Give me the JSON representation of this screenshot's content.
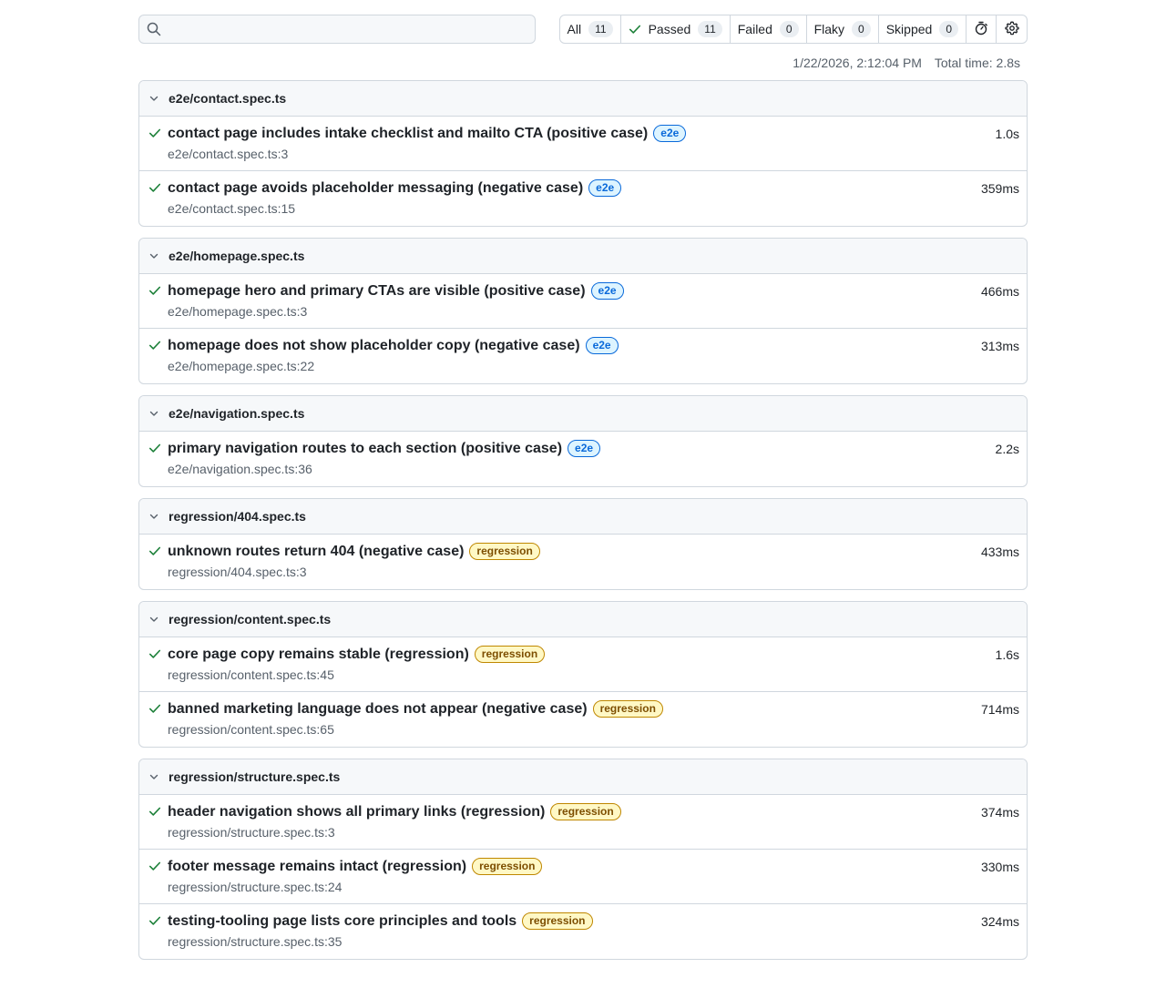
{
  "search": {
    "placeholder": "",
    "value": ""
  },
  "filters": [
    {
      "label": "All",
      "count": "11"
    },
    {
      "label": "Passed",
      "count": "11"
    },
    {
      "label": "Failed",
      "count": "0"
    },
    {
      "label": "Flaky",
      "count": "0"
    },
    {
      "label": "Skipped",
      "count": "0"
    }
  ],
  "meta": {
    "timestamp": "1/22/2026, 2:12:04 PM",
    "total_time": "Total time: 2.8s"
  },
  "colors": {
    "pass": "#1a7f37",
    "e2e": "#0969da",
    "regression": "#bf8700"
  },
  "files": [
    {
      "name": "e2e/contact.spec.ts",
      "tests": [
        {
          "title": "contact page includes intake checklist and mailto CTA (positive case)",
          "tag": "e2e",
          "loc": "e2e/contact.spec.ts:3",
          "duration": "1.0s"
        },
        {
          "title": "contact page avoids placeholder messaging (negative case)",
          "tag": "e2e",
          "loc": "e2e/contact.spec.ts:15",
          "duration": "359ms"
        }
      ]
    },
    {
      "name": "e2e/homepage.spec.ts",
      "tests": [
        {
          "title": "homepage hero and primary CTAs are visible (positive case)",
          "tag": "e2e",
          "loc": "e2e/homepage.spec.ts:3",
          "duration": "466ms"
        },
        {
          "title": "homepage does not show placeholder copy (negative case)",
          "tag": "e2e",
          "loc": "e2e/homepage.spec.ts:22",
          "duration": "313ms"
        }
      ]
    },
    {
      "name": "e2e/navigation.spec.ts",
      "tests": [
        {
          "title": "primary navigation routes to each section (positive case)",
          "tag": "e2e",
          "loc": "e2e/navigation.spec.ts:36",
          "duration": "2.2s"
        }
      ]
    },
    {
      "name": "regression/404.spec.ts",
      "tests": [
        {
          "title": "unknown routes return 404 (negative case)",
          "tag": "regression",
          "loc": "regression/404.spec.ts:3",
          "duration": "433ms"
        }
      ]
    },
    {
      "name": "regression/content.spec.ts",
      "tests": [
        {
          "title": "core page copy remains stable (regression)",
          "tag": "regression",
          "loc": "regression/content.spec.ts:45",
          "duration": "1.6s"
        },
        {
          "title": "banned marketing language does not appear (negative case)",
          "tag": "regression",
          "loc": "regression/content.spec.ts:65",
          "duration": "714ms"
        }
      ]
    },
    {
      "name": "regression/structure.spec.ts",
      "tests": [
        {
          "title": "header navigation shows all primary links (regression)",
          "tag": "regression",
          "loc": "regression/structure.spec.ts:3",
          "duration": "374ms"
        },
        {
          "title": "footer message remains intact (regression)",
          "tag": "regression",
          "loc": "regression/structure.spec.ts:24",
          "duration": "330ms"
        },
        {
          "title": "testing-tooling page lists core principles and tools",
          "tag": "regression",
          "loc": "regression/structure.spec.ts:35",
          "duration": "324ms"
        }
      ]
    }
  ]
}
